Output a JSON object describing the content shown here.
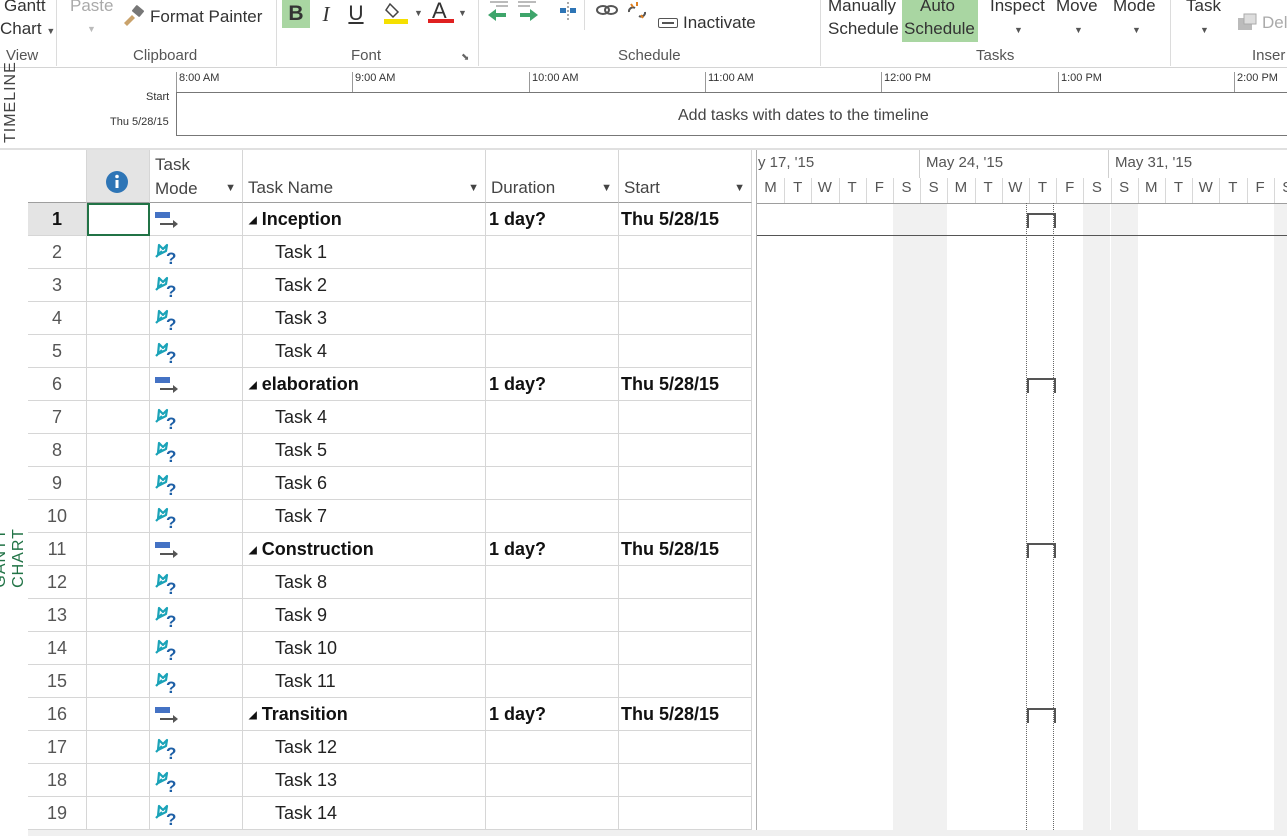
{
  "ribbon": {
    "view": {
      "gantt_line1": "Gantt",
      "gantt_line2": "Chart",
      "group_label": "View"
    },
    "clipboard": {
      "paste": "Paste",
      "format_painter": "Format Painter",
      "group_label": "Clipboard"
    },
    "font": {
      "bold": "B",
      "italic": "I",
      "underline": "U",
      "font_color_letter": "A",
      "group_label": "Font"
    },
    "schedule": {
      "inactivate": "Inactivate",
      "group_label": "Schedule"
    },
    "tasks": {
      "manually_line1": "Manually",
      "manually_line2": "Schedule",
      "auto_line1": "Auto",
      "auto_line2": "Schedule",
      "inspect": "Inspect",
      "move": "Move",
      "mode": "Mode",
      "group_label": "Tasks"
    },
    "insert": {
      "task": "Task",
      "deliverable_partial": "Del",
      "group_label": "Inser"
    }
  },
  "timeline": {
    "side_label": "TIMELINE",
    "start_label": "Start",
    "start_date": "Thu 5/28/15",
    "hint": "Add tasks with dates to the timeline",
    "ticks": [
      "8:00 AM",
      "9:00 AM",
      "10:00 AM",
      "11:00 AM",
      "12:00 PM",
      "1:00 PM",
      "2:00 PM"
    ]
  },
  "view_label": "GANTT CHART",
  "grid": {
    "columns": {
      "task_mode_line1": "Task",
      "task_mode_line2": "Mode",
      "task_name": "Task Name",
      "duration": "Duration",
      "start": "Start"
    },
    "rows": [
      {
        "id": "1",
        "mode": "auto",
        "summary": true,
        "name": "Inception",
        "duration": "1 day?",
        "start": "Thu 5/28/15"
      },
      {
        "id": "2",
        "mode": "manual",
        "summary": false,
        "name": "Task 1",
        "duration": "",
        "start": ""
      },
      {
        "id": "3",
        "mode": "manual",
        "summary": false,
        "name": "Task 2",
        "duration": "",
        "start": ""
      },
      {
        "id": "4",
        "mode": "manual",
        "summary": false,
        "name": "Task 3",
        "duration": "",
        "start": ""
      },
      {
        "id": "5",
        "mode": "manual",
        "summary": false,
        "name": "Task 4",
        "duration": "",
        "start": ""
      },
      {
        "id": "6",
        "mode": "auto",
        "summary": true,
        "name": "elaboration",
        "duration": "1 day?",
        "start": "Thu 5/28/15"
      },
      {
        "id": "7",
        "mode": "manual",
        "summary": false,
        "name": "Task 4",
        "duration": "",
        "start": ""
      },
      {
        "id": "8",
        "mode": "manual",
        "summary": false,
        "name": "Task 5",
        "duration": "",
        "start": ""
      },
      {
        "id": "9",
        "mode": "manual",
        "summary": false,
        "name": "Task 6",
        "duration": "",
        "start": ""
      },
      {
        "id": "10",
        "mode": "manual",
        "summary": false,
        "name": "Task 7",
        "duration": "",
        "start": ""
      },
      {
        "id": "11",
        "mode": "auto",
        "summary": true,
        "name": "Construction",
        "duration": "1 day?",
        "start": "Thu 5/28/15"
      },
      {
        "id": "12",
        "mode": "manual",
        "summary": false,
        "name": "Task 8",
        "duration": "",
        "start": ""
      },
      {
        "id": "13",
        "mode": "manual",
        "summary": false,
        "name": "Task 9",
        "duration": "",
        "start": ""
      },
      {
        "id": "14",
        "mode": "manual",
        "summary": false,
        "name": "Task 10",
        "duration": "",
        "start": ""
      },
      {
        "id": "15",
        "mode": "manual",
        "summary": false,
        "name": "Task 11",
        "duration": "",
        "start": ""
      },
      {
        "id": "16",
        "mode": "auto",
        "summary": true,
        "name": "Transition",
        "duration": "1 day?",
        "start": "Thu 5/28/15"
      },
      {
        "id": "17",
        "mode": "manual",
        "summary": false,
        "name": "Task 12",
        "duration": "",
        "start": ""
      },
      {
        "id": "18",
        "mode": "manual",
        "summary": false,
        "name": "Task 13",
        "duration": "",
        "start": ""
      },
      {
        "id": "19",
        "mode": "manual",
        "summary": false,
        "name": "Task 14",
        "duration": "",
        "start": ""
      }
    ]
  },
  "chart": {
    "weeks": [
      "y 17, '15",
      "May 24, '15",
      "May 31, '15"
    ],
    "days": [
      "M",
      "T",
      "W",
      "T",
      "F",
      "S",
      "S",
      "M",
      "T",
      "W",
      "T",
      "F",
      "S",
      "S",
      "M",
      "T",
      "W",
      "T",
      "F",
      "S"
    ]
  },
  "colors": {
    "accent": "#217346",
    "ribbon_highlight": "#a9d6a2",
    "info_icon": "#2e75b6"
  }
}
